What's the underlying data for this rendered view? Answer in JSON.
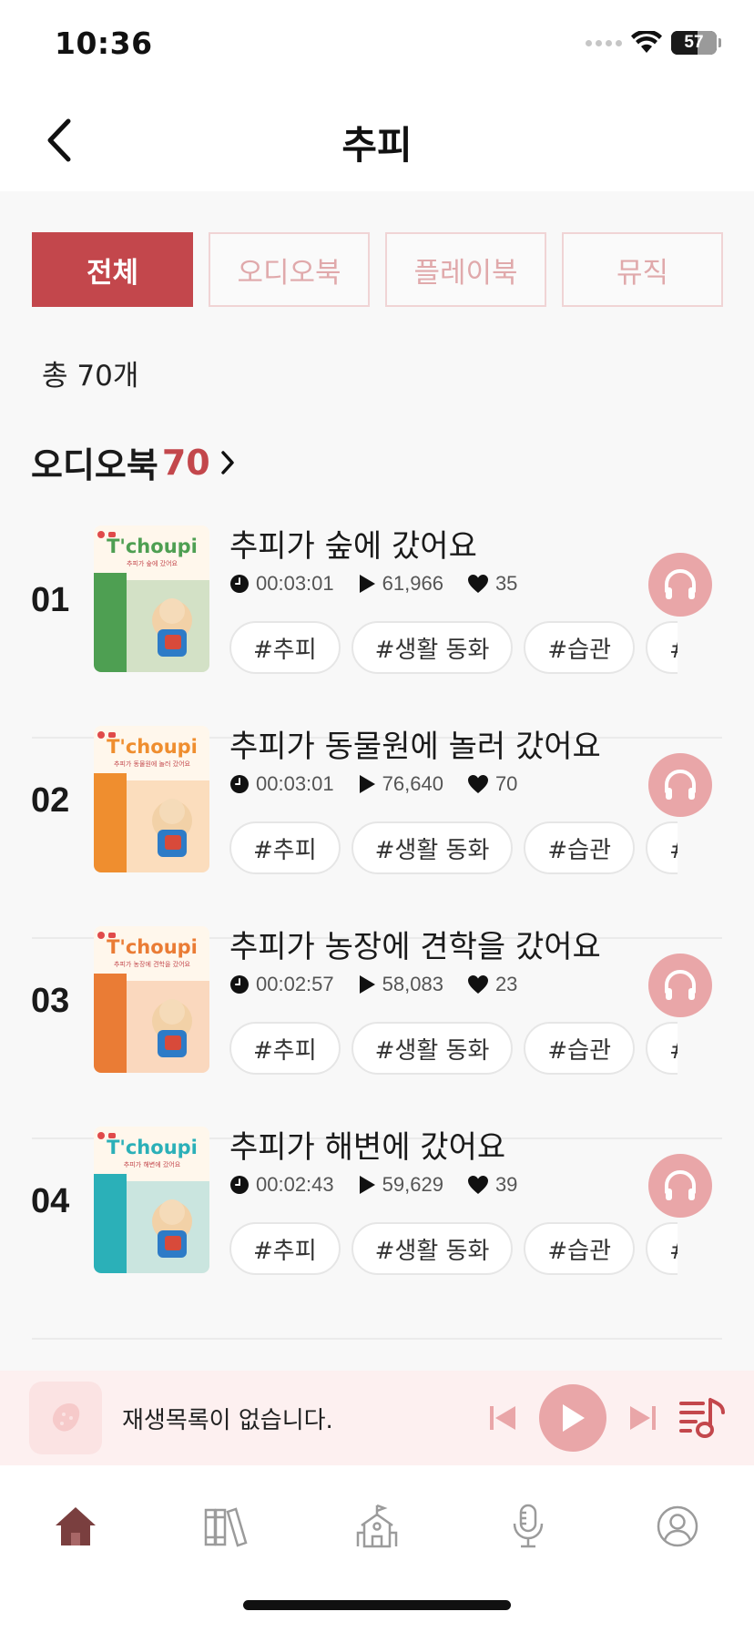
{
  "status_bar": {
    "time": "10:36",
    "battery": "57",
    "battery_level": 0.57
  },
  "header": {
    "title": "추피"
  },
  "tabs": [
    {
      "label": "전체",
      "active": true
    },
    {
      "label": "오디오북",
      "active": false
    },
    {
      "label": "플레이북",
      "active": false
    },
    {
      "label": "뮤직",
      "active": false
    }
  ],
  "total": "총 70개",
  "section": {
    "title": "오디오북",
    "count": "70"
  },
  "items": [
    {
      "rank": "01",
      "title": "추피가 숲에 갔어요",
      "duration": "00:03:01",
      "plays": "61,966",
      "likes": "35",
      "tags": [
        "#추피",
        "#생활 동화",
        "#습관",
        "#가"
      ],
      "cover_color": "#4e9f52",
      "cover_subtitle": "추피가 숲에 갔어요"
    },
    {
      "rank": "02",
      "title": "추피가 동물원에 놀러 갔어요",
      "duration": "00:03:01",
      "plays": "76,640",
      "likes": "70",
      "tags": [
        "#추피",
        "#생활 동화",
        "#습관",
        "#가"
      ],
      "cover_color": "#ef8e2f",
      "cover_subtitle": "추피가 동물원에 놀러 갔어요"
    },
    {
      "rank": "03",
      "title": "추피가 농장에 견학을 갔어요",
      "duration": "00:02:57",
      "plays": "58,083",
      "likes": "23",
      "tags": [
        "#추피",
        "#생활 동화",
        "#습관",
        "#가"
      ],
      "cover_color": "#ea7c35",
      "cover_subtitle": "추피가 농장에 견학을 갔어요"
    },
    {
      "rank": "04",
      "title": "추피가 해변에 갔어요",
      "duration": "00:02:43",
      "plays": "59,629",
      "likes": "39",
      "tags": [
        "#추피",
        "#생활 동화",
        "#습관",
        "#가"
      ],
      "cover_color": "#2bb0b8",
      "cover_subtitle": "추피가 해변에 갔어요"
    }
  ],
  "cover_brand": "T'choupi",
  "player": {
    "text": "재생목록이 없습니다."
  },
  "nav": [
    {
      "name": "home",
      "active": true
    },
    {
      "name": "library",
      "active": false
    },
    {
      "name": "school",
      "active": false
    },
    {
      "name": "microphone",
      "active": false
    },
    {
      "name": "profile",
      "active": false
    }
  ],
  "colors": {
    "accent": "#c3474c",
    "accent_light": "#e9a6a8",
    "nav_active": "#7a3f3f",
    "nav_inactive": "#9b9b9b"
  }
}
